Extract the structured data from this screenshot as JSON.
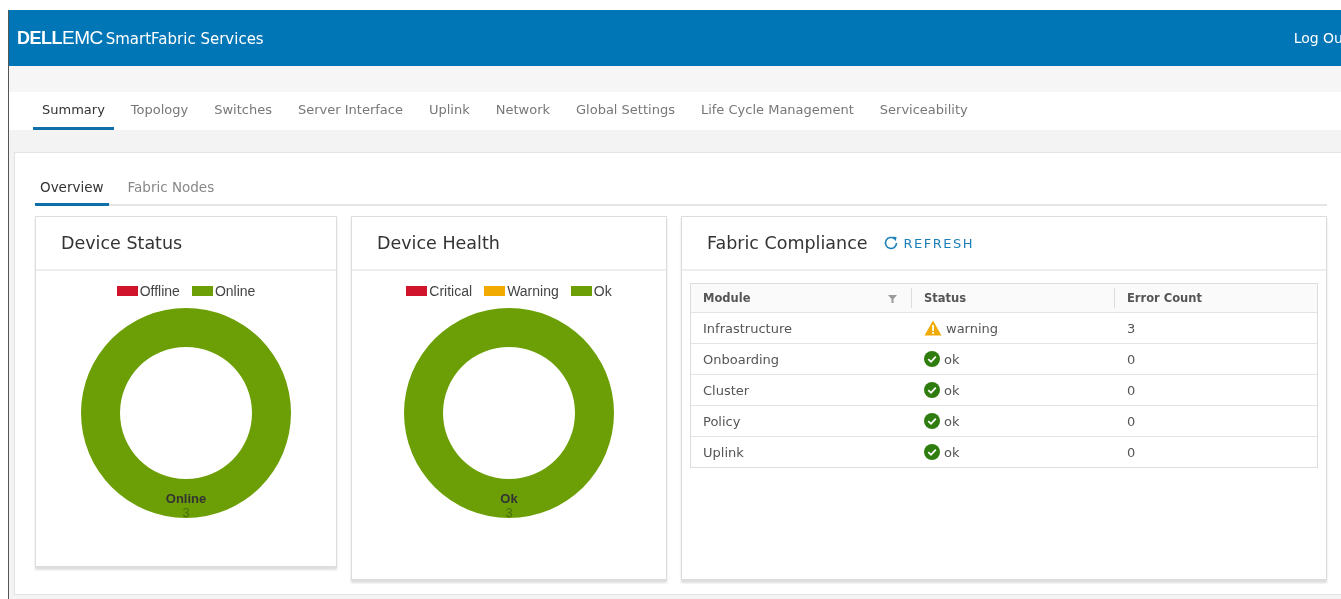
{
  "header": {
    "brand_bold": "DELL",
    "brand_light": "EMC",
    "product": "SmartFabric Services",
    "logout": "Log Ou"
  },
  "tabs": [
    {
      "label": "Summary",
      "selected": true
    },
    {
      "label": "Topology",
      "selected": false
    },
    {
      "label": "Switches",
      "selected": false
    },
    {
      "label": "Server Interface",
      "selected": false
    },
    {
      "label": "Uplink",
      "selected": false
    },
    {
      "label": "Network",
      "selected": false
    },
    {
      "label": "Global Settings",
      "selected": false
    },
    {
      "label": "Life Cycle Management",
      "selected": false
    },
    {
      "label": "Serviceability",
      "selected": false
    }
  ],
  "subtabs": [
    {
      "label": "Overview",
      "selected": true
    },
    {
      "label": "Fabric Nodes",
      "selected": false
    }
  ],
  "status_panels": [
    {
      "title": "Device Status",
      "chart_data": {
        "type": "pie",
        "categories": [
          "Offline",
          "Online"
        ],
        "values": [
          0,
          3
        ],
        "colors": [
          "#d0142c",
          "#6c9f05"
        ],
        "data_labels": true
      }
    },
    {
      "title": "Device Health",
      "chart_data": {
        "type": "pie",
        "categories": [
          "Critical",
          "Warning",
          "Ok"
        ],
        "values": [
          0,
          0,
          3
        ],
        "colors": [
          "#d0142c",
          "#f1ab00",
          "#6c9f05"
        ],
        "data_labels": true
      }
    }
  ],
  "compliance": {
    "title": "Fabric Compliance",
    "refresh": "REFRESH",
    "columns": [
      {
        "label": "Module",
        "filter": true
      },
      {
        "label": "Status",
        "filter": false
      },
      {
        "label": "Error Count",
        "filter": false
      }
    ],
    "rows": [
      {
        "module": "Infrastructure",
        "kind": "warning",
        "status": "warning",
        "errors": "3"
      },
      {
        "module": "Onboarding",
        "kind": "ok",
        "status": "ok",
        "errors": "0"
      },
      {
        "module": "Cluster",
        "kind": "ok",
        "status": "ok",
        "errors": "0"
      },
      {
        "module": "Policy",
        "kind": "ok",
        "status": "ok",
        "errors": "0"
      },
      {
        "module": "Uplink",
        "kind": "ok",
        "status": "ok",
        "errors": "0"
      }
    ]
  }
}
